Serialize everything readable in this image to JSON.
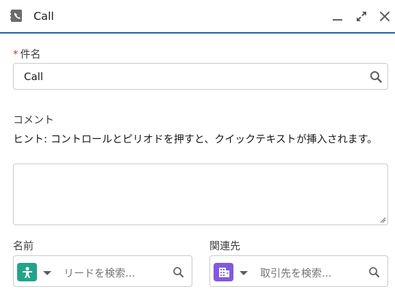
{
  "header": {
    "title": "Call",
    "icon": "call-log-icon"
  },
  "subject": {
    "label": "件名",
    "required_mark": "*",
    "value": "Call"
  },
  "comment": {
    "label": "コメント",
    "hint": "ヒント: コントロールとピリオドを押すと、クイックテキストが挿入されます。"
  },
  "name_lookup": {
    "label": "名前",
    "placeholder": "リードを検索...",
    "icon": "lead-icon",
    "color": "#22a48a"
  },
  "related_lookup": {
    "label": "関連先",
    "placeholder": "取引先を検索...",
    "icon": "account-icon",
    "color": "#7f5ae0"
  },
  "colors": {
    "header_border": "#1b5f9e",
    "required": "#c23934"
  }
}
